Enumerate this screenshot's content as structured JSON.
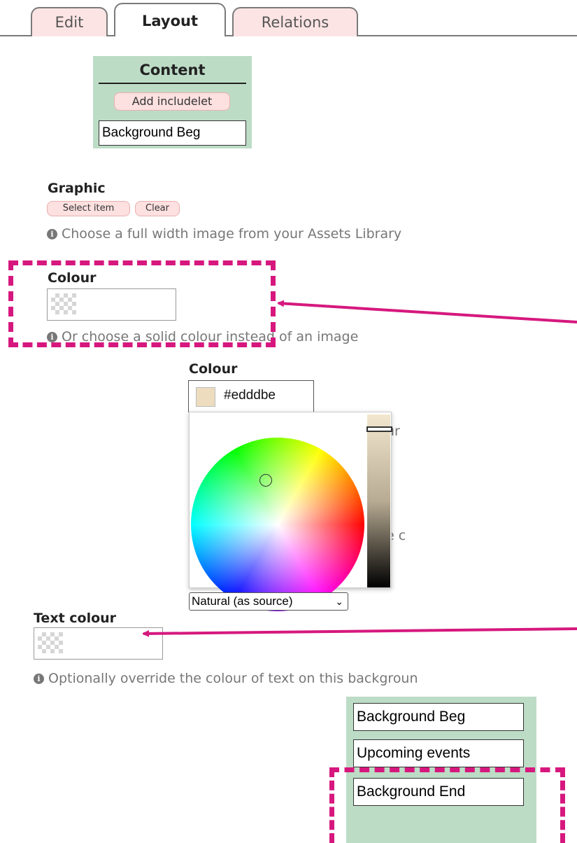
{
  "tabs": [
    {
      "label": "Edit",
      "active": false
    },
    {
      "label": "Layout",
      "active": true
    },
    {
      "label": "Relations",
      "active": false
    }
  ],
  "content_panel": {
    "title": "Content",
    "add_button": "Add includelet",
    "item": "Background Beg"
  },
  "graphic": {
    "label": "Graphic",
    "select_button": "Select item",
    "clear_button": "Clear",
    "hint": "Choose a full width image from your Assets Library"
  },
  "colour": {
    "label": "Colour",
    "hint": "Or choose a solid colour instead of an image"
  },
  "picker": {
    "label": "Colour",
    "value": "#edddbe",
    "swatch_color": "#edddbe",
    "mode_select": "Natural (as source)",
    "hidden_text_fragment_1": "ur",
    "hidden_text_fragment_2": "e c"
  },
  "text_colour": {
    "label": "Text colour",
    "hint": "Optionally override the colour of text on this backgroun"
  },
  "bottom_panel": {
    "items": [
      "Background Beg",
      "Upcoming events",
      "Background End"
    ]
  },
  "colors": {
    "tab_inactive_bg": "#fde4e4",
    "panel_green": "#bddcc6",
    "annotation_magenta": "#d6187e"
  }
}
